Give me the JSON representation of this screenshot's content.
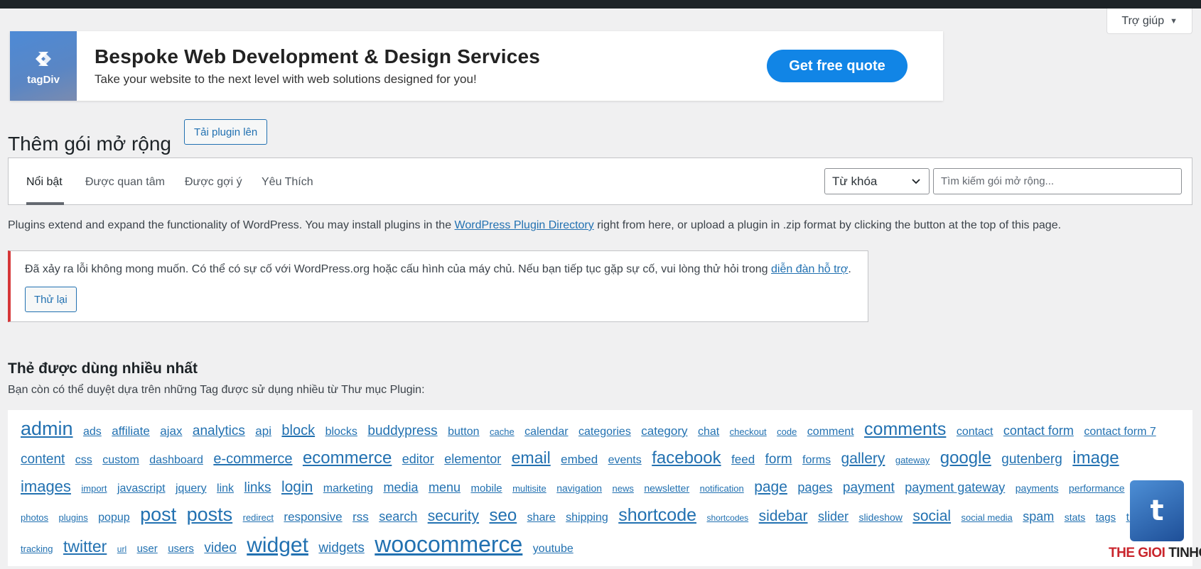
{
  "help_tab": {
    "label": "Trợ giúp",
    "arrow": "▼"
  },
  "banner": {
    "logo_name": "tagDiv",
    "title": "Bespoke Web Development & Design Services",
    "subtitle": "Take your website to the next level with web solutions designed for you!",
    "cta": "Get free quote"
  },
  "page": {
    "title": "Thêm gói mở rộng",
    "upload_label": "Tải plugin lên"
  },
  "filter": {
    "tabs": [
      {
        "label": "Nổi bật"
      },
      {
        "label": "Được quan tâm"
      },
      {
        "label": "Được gợi ý"
      },
      {
        "label": "Yêu Thích"
      }
    ],
    "search_type": "Từ khóa",
    "search_placeholder": "Tìm kiếm gói mở rộng..."
  },
  "intro": {
    "before": "Plugins extend and expand the functionality of WordPress. You may install plugins in the ",
    "link": "WordPress Plugin Directory",
    "after": " right from here, or upload a plugin in .zip format by clicking the button at the top of this page."
  },
  "notice": {
    "text": "Đã xảy ra lỗi không mong muốn. Có thể có sự cố với WordPress.org hoặc cấu hình của máy chủ. Nếu bạn tiếp tục gặp sự cố, vui lòng thử hỏi trong ",
    "link": "diễn đàn hỗ trợ",
    "end": ".",
    "retry_label": "Thử lại"
  },
  "tags_section": {
    "title": "Thẻ được dùng nhiều nhất",
    "description": "Bạn còn có thể duyệt dựa trên những Tag được sử dụng nhiều từ Thư mục Plugin:",
    "tags": [
      {
        "label": "admin",
        "size": 27
      },
      {
        "label": "ads",
        "size": 16
      },
      {
        "label": "affiliate",
        "size": 17
      },
      {
        "label": "ajax",
        "size": 17
      },
      {
        "label": "analytics",
        "size": 19
      },
      {
        "label": "api",
        "size": 17
      },
      {
        "label": "block",
        "size": 20
      },
      {
        "label": "blocks",
        "size": 16
      },
      {
        "label": "buddypress",
        "size": 19
      },
      {
        "label": "button",
        "size": 16
      },
      {
        "label": "cache",
        "size": 13
      },
      {
        "label": "calendar",
        "size": 16
      },
      {
        "label": "categories",
        "size": 16
      },
      {
        "label": "category",
        "size": 17
      },
      {
        "label": "chat",
        "size": 16
      },
      {
        "label": "checkout",
        "size": 13
      },
      {
        "label": "code",
        "size": 13
      },
      {
        "label": "comment",
        "size": 16
      },
      {
        "label": "comments",
        "size": 25
      },
      {
        "label": "contact",
        "size": 16
      },
      {
        "label": "contact form",
        "size": 18
      },
      {
        "label": "contact form 7",
        "size": 16
      },
      {
        "label": "content",
        "size": 19
      },
      {
        "label": "css",
        "size": 16
      },
      {
        "label": "custom",
        "size": 16
      },
      {
        "label": "dashboard",
        "size": 16
      },
      {
        "label": "e-commerce",
        "size": 20
      },
      {
        "label": "ecommerce",
        "size": 24
      },
      {
        "label": "editor",
        "size": 18
      },
      {
        "label": "elementor",
        "size": 18
      },
      {
        "label": "email",
        "size": 23
      },
      {
        "label": "embed",
        "size": 17
      },
      {
        "label": "events",
        "size": 16
      },
      {
        "label": "facebook",
        "size": 24
      },
      {
        "label": "feed",
        "size": 17
      },
      {
        "label": "form",
        "size": 19
      },
      {
        "label": "forms",
        "size": 16
      },
      {
        "label": "gallery",
        "size": 21
      },
      {
        "label": "gateway",
        "size": 13
      },
      {
        "label": "google",
        "size": 24
      },
      {
        "label": "gutenberg",
        "size": 19
      },
      {
        "label": "image",
        "size": 24
      },
      {
        "label": "images",
        "size": 22
      },
      {
        "label": "import",
        "size": 13
      },
      {
        "label": "javascript",
        "size": 16
      },
      {
        "label": "jquery",
        "size": 16
      },
      {
        "label": "link",
        "size": 16
      },
      {
        "label": "links",
        "size": 19
      },
      {
        "label": "login",
        "size": 21
      },
      {
        "label": "marketing",
        "size": 16
      },
      {
        "label": "media",
        "size": 18
      },
      {
        "label": "menu",
        "size": 18
      },
      {
        "label": "mobile",
        "size": 15
      },
      {
        "label": "multisite",
        "size": 13
      },
      {
        "label": "navigation",
        "size": 14
      },
      {
        "label": "news",
        "size": 13
      },
      {
        "label": "newsletter",
        "size": 14
      },
      {
        "label": "notification",
        "size": 13
      },
      {
        "label": "page",
        "size": 21
      },
      {
        "label": "pages",
        "size": 18
      },
      {
        "label": "payment",
        "size": 19
      },
      {
        "label": "payment gateway",
        "size": 18
      },
      {
        "label": "payments",
        "size": 14
      },
      {
        "label": "performance",
        "size": 14
      },
      {
        "label": "photo",
        "size": 13
      },
      {
        "label": "photos",
        "size": 13
      },
      {
        "label": "plugins",
        "size": 13
      },
      {
        "label": "popup",
        "size": 16
      },
      {
        "label": "post",
        "size": 27
      },
      {
        "label": "posts",
        "size": 27
      },
      {
        "label": "redirect",
        "size": 13
      },
      {
        "label": "responsive",
        "size": 17
      },
      {
        "label": "rss",
        "size": 17
      },
      {
        "label": "search",
        "size": 18
      },
      {
        "label": "security",
        "size": 21
      },
      {
        "label": "seo",
        "size": 24
      },
      {
        "label": "share",
        "size": 16
      },
      {
        "label": "shipping",
        "size": 16
      },
      {
        "label": "shortcode",
        "size": 25
      },
      {
        "label": "shortcodes",
        "size": 12
      },
      {
        "label": "sidebar",
        "size": 21
      },
      {
        "label": "slider",
        "size": 18
      },
      {
        "label": "slideshow",
        "size": 14
      },
      {
        "label": "social",
        "size": 21
      },
      {
        "label": "social media",
        "size": 13
      },
      {
        "label": "spam",
        "size": 18
      },
      {
        "label": "stats",
        "size": 14
      },
      {
        "label": "tags",
        "size": 15
      },
      {
        "label": "theme",
        "size": 16
      },
      {
        "label": "tracking",
        "size": 13
      },
      {
        "label": "twitter",
        "size": 23
      },
      {
        "label": "url",
        "size": 12
      },
      {
        "label": "user",
        "size": 15
      },
      {
        "label": "users",
        "size": 15
      },
      {
        "label": "video",
        "size": 19
      },
      {
        "label": "widget",
        "size": 30
      },
      {
        "label": "widgets",
        "size": 19
      },
      {
        "label": "woocommerce",
        "size": 32
      },
      {
        "label": "youtube",
        "size": 16
      }
    ]
  },
  "watermark": {
    "part1": "THE GIOI ",
    "part2": "TINHOC"
  },
  "colors": {
    "link": "#2271b1",
    "error_border": "#d63638",
    "cta": "#1185e6",
    "admin_bar": "#1d2327"
  }
}
